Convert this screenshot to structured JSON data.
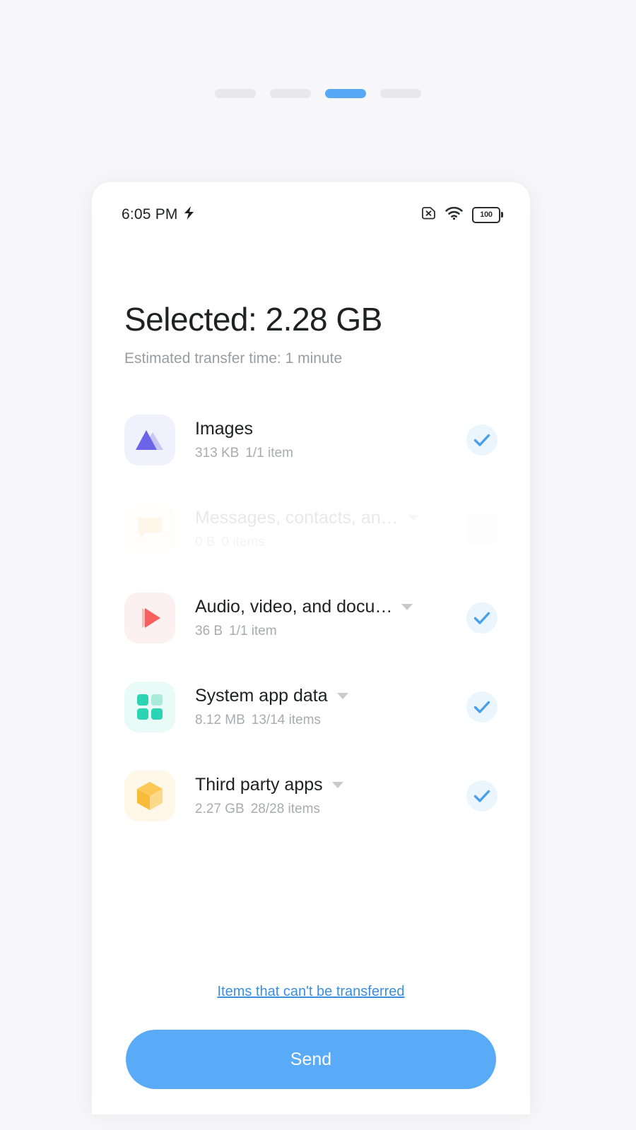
{
  "theme": {
    "page_background": "#f7f7f9",
    "accent": "#57a9f5",
    "link": "#3b8ee0",
    "check": "#4a9fe8"
  },
  "step_indicator": {
    "steps": [
      {
        "label": "step-1",
        "active": false
      },
      {
        "label": "step-2",
        "active": false
      },
      {
        "label": "step-3",
        "active": true
      },
      {
        "label": "step-4",
        "active": false
      }
    ]
  },
  "status_bar": {
    "time": "6:05 PM",
    "time_icon": "lightning-bolt-icon",
    "sim_icon": "sim-card-off-icon",
    "wifi_icon": "wifi-icon",
    "battery_level": "100",
    "battery_icon": "battery-icon"
  },
  "header": {
    "title": "Selected: 2.28 GB",
    "subtitle": "Estimated transfer time: 1 minute"
  },
  "list": {
    "rows": [
      {
        "name": "images",
        "icon": "mountain-image-icon",
        "title": "Images",
        "size": "313 KB",
        "items": "1/1 item",
        "has_caret": false,
        "checked": true,
        "disabled": false
      },
      {
        "name": "messages-contacts",
        "icon": "chat-bubble-icon",
        "title": "Messages, contacts, an…",
        "size": "0 B",
        "items": "0 items",
        "has_caret": true,
        "checked": false,
        "disabled": true
      },
      {
        "name": "audio-video-documents",
        "icon": "play-media-icon",
        "title": "Audio, video, and docu…",
        "size": "36 B",
        "items": "1/1 item",
        "has_caret": true,
        "checked": true,
        "disabled": false
      },
      {
        "name": "system-app-data",
        "icon": "grid-squares-icon",
        "title": "System app data",
        "size": "8.12 MB",
        "items": "13/14 items",
        "has_caret": true,
        "checked": true,
        "disabled": false
      },
      {
        "name": "third-party-apps",
        "icon": "cube-icon",
        "title": "Third party apps",
        "size": "2.27 GB",
        "items": "28/28 items",
        "has_caret": true,
        "checked": true,
        "disabled": false
      }
    ]
  },
  "footer": {
    "cant_transfer_link": "Items that can't be transferred",
    "send_label": "Send"
  }
}
